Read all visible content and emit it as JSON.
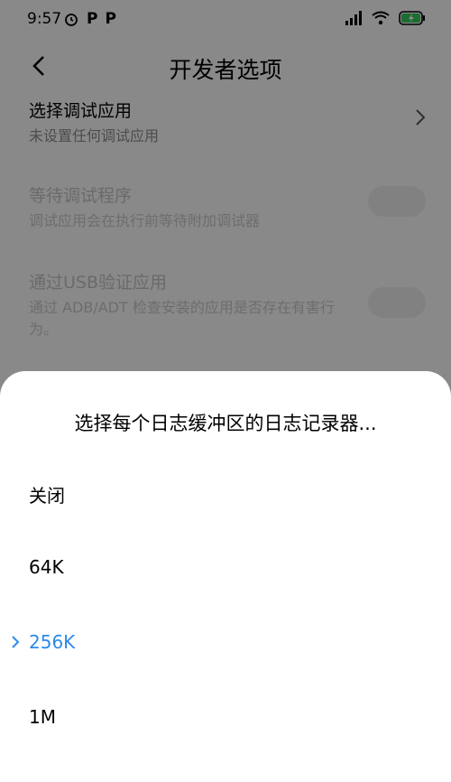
{
  "status_bar": {
    "time": "9:57",
    "left_icons": [
      "alarm-icon",
      "parking-p-icon",
      "parking-p-icon"
    ],
    "right_icons": [
      "signal-icon",
      "wifi-icon",
      "battery-charging-icon"
    ]
  },
  "header": {
    "title": "开发者选项"
  },
  "settings": [
    {
      "title": "选择调试应用",
      "subtitle": "未设置任何调试应用",
      "control": "chevron",
      "enabled": true
    },
    {
      "title": "等待调试程序",
      "subtitle": "调试应用会在执行前等待附加调试器",
      "control": "toggle",
      "enabled": false
    },
    {
      "title": "通过USB验证应用",
      "subtitle": "通过 ADB/ADT 检查安装的应用是否存在有害行为。",
      "control": "toggle",
      "enabled": false
    }
  ],
  "dialog": {
    "title": "选择每个日志缓冲区的日志记录器...",
    "options": [
      {
        "label": "关闭",
        "selected": false
      },
      {
        "label": "64K",
        "selected": false
      },
      {
        "label": "256K",
        "selected": true
      },
      {
        "label": "1M",
        "selected": false
      }
    ]
  },
  "colors": {
    "accent": "#2c8be8",
    "sheet_bg": "#ffffff",
    "scrim": "rgba(0,0,0,0.45)"
  }
}
